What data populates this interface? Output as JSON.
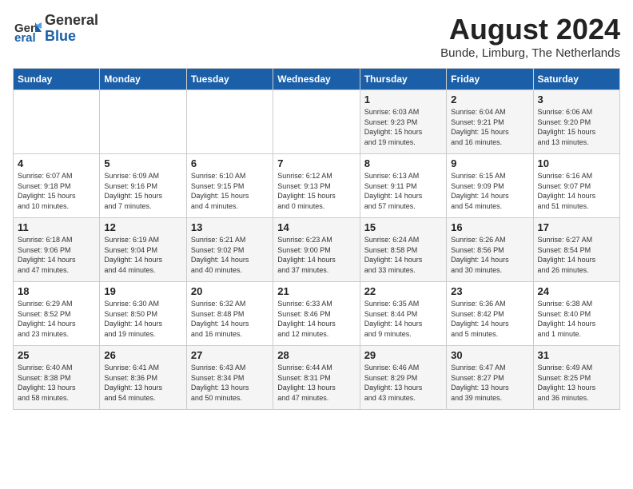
{
  "header": {
    "logo_general": "General",
    "logo_blue": "Blue",
    "title": "August 2024",
    "subtitle": "Bunde, Limburg, The Netherlands"
  },
  "days_of_week": [
    "Sunday",
    "Monday",
    "Tuesday",
    "Wednesday",
    "Thursday",
    "Friday",
    "Saturday"
  ],
  "weeks": [
    [
      {
        "day": "",
        "info": ""
      },
      {
        "day": "",
        "info": ""
      },
      {
        "day": "",
        "info": ""
      },
      {
        "day": "",
        "info": ""
      },
      {
        "day": "1",
        "info": "Sunrise: 6:03 AM\nSunset: 9:23 PM\nDaylight: 15 hours\nand 19 minutes."
      },
      {
        "day": "2",
        "info": "Sunrise: 6:04 AM\nSunset: 9:21 PM\nDaylight: 15 hours\nand 16 minutes."
      },
      {
        "day": "3",
        "info": "Sunrise: 6:06 AM\nSunset: 9:20 PM\nDaylight: 15 hours\nand 13 minutes."
      }
    ],
    [
      {
        "day": "4",
        "info": "Sunrise: 6:07 AM\nSunset: 9:18 PM\nDaylight: 15 hours\nand 10 minutes."
      },
      {
        "day": "5",
        "info": "Sunrise: 6:09 AM\nSunset: 9:16 PM\nDaylight: 15 hours\nand 7 minutes."
      },
      {
        "day": "6",
        "info": "Sunrise: 6:10 AM\nSunset: 9:15 PM\nDaylight: 15 hours\nand 4 minutes."
      },
      {
        "day": "7",
        "info": "Sunrise: 6:12 AM\nSunset: 9:13 PM\nDaylight: 15 hours\nand 0 minutes."
      },
      {
        "day": "8",
        "info": "Sunrise: 6:13 AM\nSunset: 9:11 PM\nDaylight: 14 hours\nand 57 minutes."
      },
      {
        "day": "9",
        "info": "Sunrise: 6:15 AM\nSunset: 9:09 PM\nDaylight: 14 hours\nand 54 minutes."
      },
      {
        "day": "10",
        "info": "Sunrise: 6:16 AM\nSunset: 9:07 PM\nDaylight: 14 hours\nand 51 minutes."
      }
    ],
    [
      {
        "day": "11",
        "info": "Sunrise: 6:18 AM\nSunset: 9:06 PM\nDaylight: 14 hours\nand 47 minutes."
      },
      {
        "day": "12",
        "info": "Sunrise: 6:19 AM\nSunset: 9:04 PM\nDaylight: 14 hours\nand 44 minutes."
      },
      {
        "day": "13",
        "info": "Sunrise: 6:21 AM\nSunset: 9:02 PM\nDaylight: 14 hours\nand 40 minutes."
      },
      {
        "day": "14",
        "info": "Sunrise: 6:23 AM\nSunset: 9:00 PM\nDaylight: 14 hours\nand 37 minutes."
      },
      {
        "day": "15",
        "info": "Sunrise: 6:24 AM\nSunset: 8:58 PM\nDaylight: 14 hours\nand 33 minutes."
      },
      {
        "day": "16",
        "info": "Sunrise: 6:26 AM\nSunset: 8:56 PM\nDaylight: 14 hours\nand 30 minutes."
      },
      {
        "day": "17",
        "info": "Sunrise: 6:27 AM\nSunset: 8:54 PM\nDaylight: 14 hours\nand 26 minutes."
      }
    ],
    [
      {
        "day": "18",
        "info": "Sunrise: 6:29 AM\nSunset: 8:52 PM\nDaylight: 14 hours\nand 23 minutes."
      },
      {
        "day": "19",
        "info": "Sunrise: 6:30 AM\nSunset: 8:50 PM\nDaylight: 14 hours\nand 19 minutes."
      },
      {
        "day": "20",
        "info": "Sunrise: 6:32 AM\nSunset: 8:48 PM\nDaylight: 14 hours\nand 16 minutes."
      },
      {
        "day": "21",
        "info": "Sunrise: 6:33 AM\nSunset: 8:46 PM\nDaylight: 14 hours\nand 12 minutes."
      },
      {
        "day": "22",
        "info": "Sunrise: 6:35 AM\nSunset: 8:44 PM\nDaylight: 14 hours\nand 9 minutes."
      },
      {
        "day": "23",
        "info": "Sunrise: 6:36 AM\nSunset: 8:42 PM\nDaylight: 14 hours\nand 5 minutes."
      },
      {
        "day": "24",
        "info": "Sunrise: 6:38 AM\nSunset: 8:40 PM\nDaylight: 14 hours\nand 1 minute."
      }
    ],
    [
      {
        "day": "25",
        "info": "Sunrise: 6:40 AM\nSunset: 8:38 PM\nDaylight: 13 hours\nand 58 minutes."
      },
      {
        "day": "26",
        "info": "Sunrise: 6:41 AM\nSunset: 8:36 PM\nDaylight: 13 hours\nand 54 minutes."
      },
      {
        "day": "27",
        "info": "Sunrise: 6:43 AM\nSunset: 8:34 PM\nDaylight: 13 hours\nand 50 minutes."
      },
      {
        "day": "28",
        "info": "Sunrise: 6:44 AM\nSunset: 8:31 PM\nDaylight: 13 hours\nand 47 minutes."
      },
      {
        "day": "29",
        "info": "Sunrise: 6:46 AM\nSunset: 8:29 PM\nDaylight: 13 hours\nand 43 minutes."
      },
      {
        "day": "30",
        "info": "Sunrise: 6:47 AM\nSunset: 8:27 PM\nDaylight: 13 hours\nand 39 minutes."
      },
      {
        "day": "31",
        "info": "Sunrise: 6:49 AM\nSunset: 8:25 PM\nDaylight: 13 hours\nand 36 minutes."
      }
    ]
  ]
}
